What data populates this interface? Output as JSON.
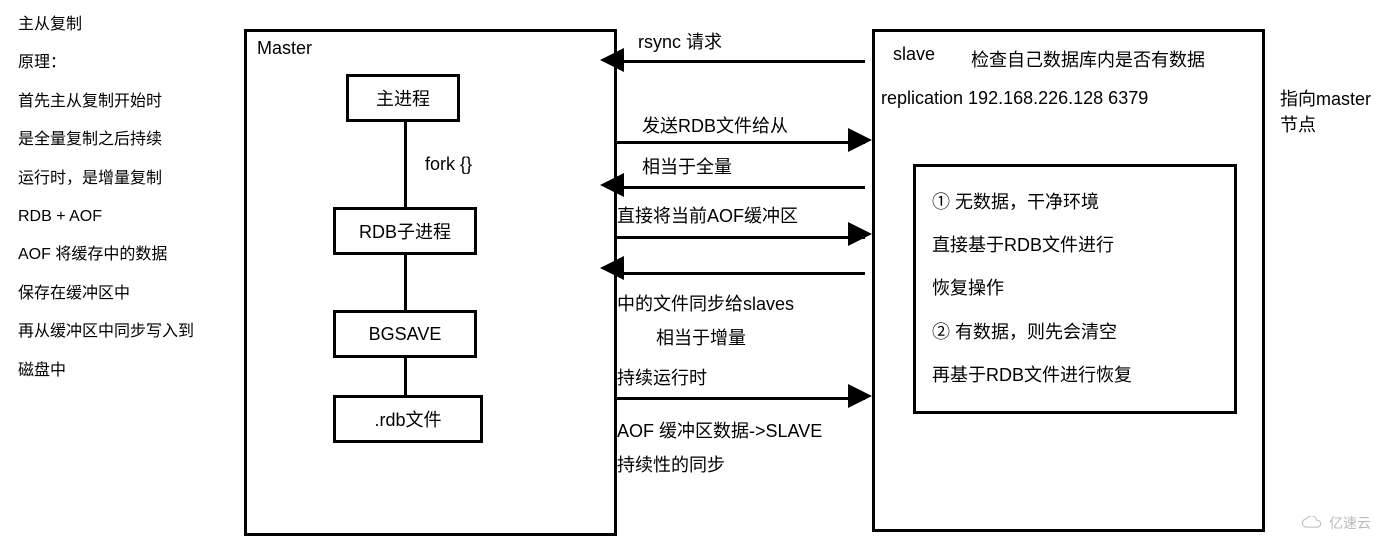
{
  "left": {
    "title": "主从复制",
    "p1": "原理：",
    "p2": "首先主从复制开始时",
    "p3": "是全量复制之后持续",
    "p4": "运行时，是增量复制",
    "p5": "RDB + AOF",
    "p6": "AOF 将缓存中的数据",
    "p7": "保存在缓冲区中",
    "p8": "再从缓冲区中同步写入到",
    "p9": "磁盘中"
  },
  "master": {
    "label": "Master",
    "box1": "主进程",
    "fork": "fork {}",
    "box2": "RDB子进程",
    "box3": "BGSAVE",
    "box4": ".rdb文件"
  },
  "mid": {
    "m1": "rsync 请求",
    "m2": "发送RDB文件给从",
    "m3": "相当于全量",
    "m4": "直接将当前AOF缓冲区",
    "m5": "中的文件同步给slaves",
    "m6": "相当于增量",
    "m7": "持续运行时",
    "m8": "AOF 缓冲区数据->SLAVE",
    "m9": "持续性的同步"
  },
  "slave": {
    "label": "slave",
    "top1": "检查自己数据库内是否有数据",
    "top2": "replication 192.168.226.128 6379",
    "inner1": "① 无数据，干净环境",
    "inner2": "直接基于RDB文件进行",
    "inner3": "恢复操作",
    "inner4": "② 有数据，则先会清空",
    "inner5": "再基于RDB文件进行恢复"
  },
  "right": "指向master节点",
  "watermark": "亿速云"
}
